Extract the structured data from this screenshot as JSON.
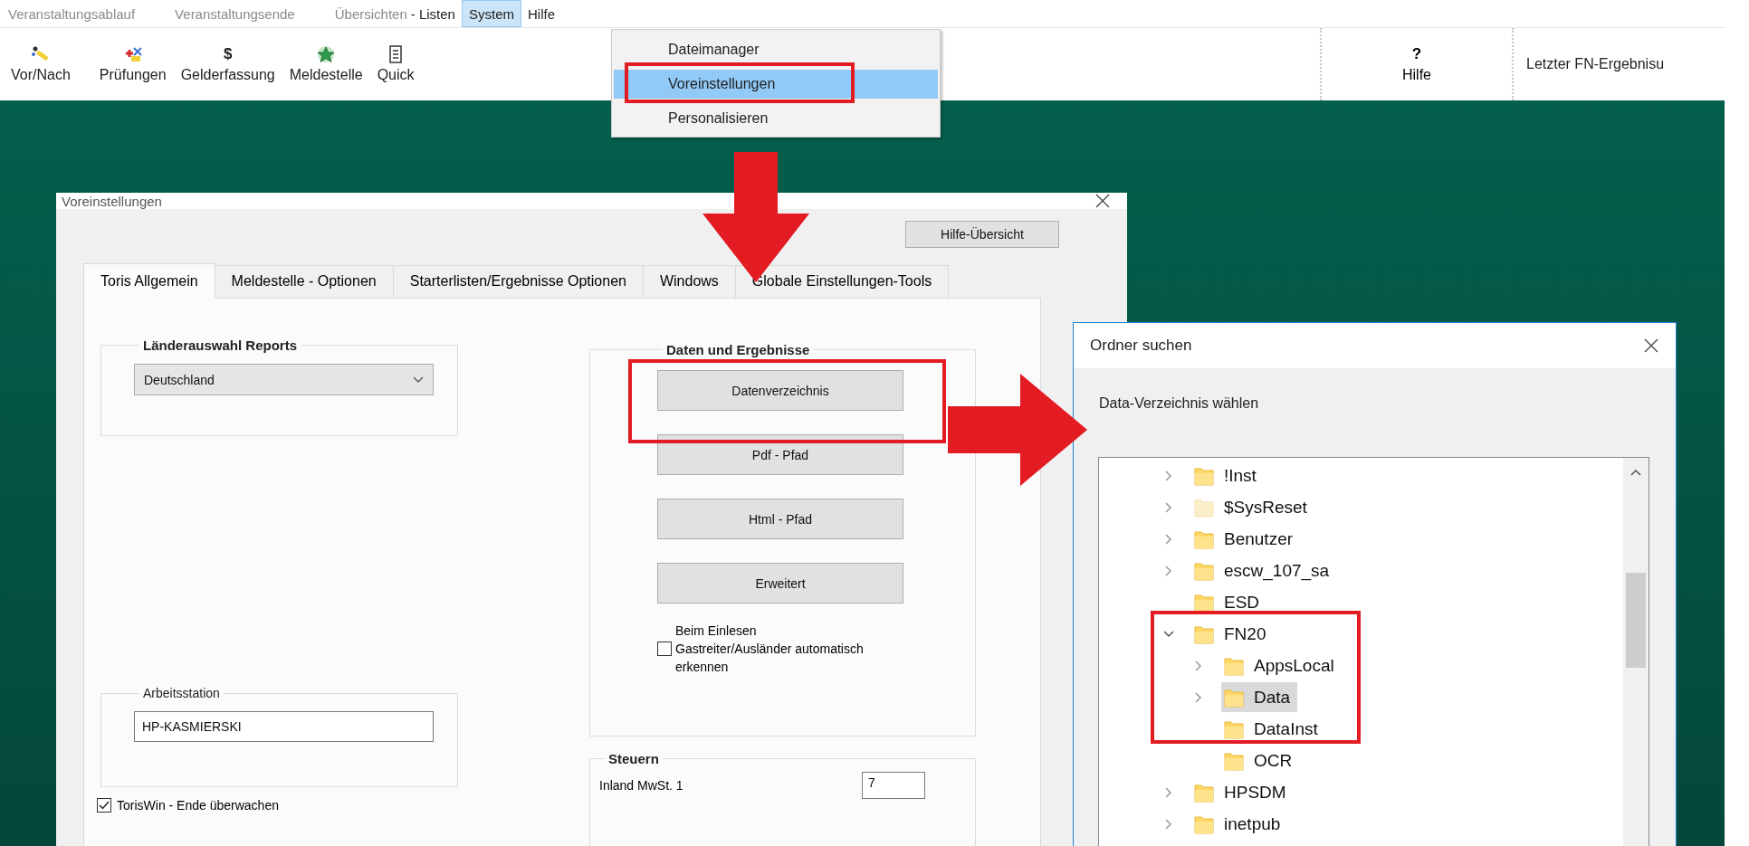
{
  "menu_bar": [
    {
      "label": "Veranstaltungsablauf",
      "disabled": true,
      "selected": false
    },
    {
      "label": "Veranstaltungsende",
      "disabled": true,
      "selected": false
    },
    {
      "label": "Übersichten",
      "disabled": true,
      "selected": false
    },
    {
      "label": "- Listen",
      "disabled": false,
      "selected": false
    },
    {
      "label": "System",
      "disabled": false,
      "selected": true
    },
    {
      "label": "Hilfe",
      "disabled": false,
      "selected": false
    }
  ],
  "system_menu": {
    "items": [
      {
        "label": "Dateimanager",
        "selected": false
      },
      {
        "label": "Voreinstellungen",
        "selected": true
      },
      {
        "label": "Personalisieren",
        "selected": false
      }
    ]
  },
  "toolbar": {
    "buttons": [
      {
        "label": "Vor/Nach",
        "kind": "wand"
      },
      {
        "label": "Prüfungen",
        "kind": "plus"
      },
      {
        "label": "Gelderfassung",
        "kind": "glyph",
        "glyph": "$"
      },
      {
        "label": "Meldestelle",
        "kind": "star"
      },
      {
        "label": "Quick",
        "kind": "document"
      }
    ],
    "help_button": {
      "label": "Hilfe",
      "glyph": "?"
    },
    "status_text": "Letzter FN-Ergebnisu"
  },
  "settings_dialog": {
    "title": "Voreinstellungen",
    "help_button": "Hilfe-Übersicht",
    "tabs": [
      {
        "label": "Toris Allgemein",
        "selected": true
      },
      {
        "label": "Meldestelle - Optionen",
        "selected": false
      },
      {
        "label": "Starterlisten/Ergebnisse Optionen",
        "selected": false
      },
      {
        "label": "Windows",
        "selected": false
      },
      {
        "label": "Globale Einstellungen-Tools",
        "selected": false
      }
    ],
    "country_group": {
      "title": "Länderauswahl Reports",
      "value": "Deutschland"
    },
    "workstation_group": {
      "title": "Arbeitsstation",
      "value": "HP-KASMIERSKI"
    },
    "monitor_checkbox": {
      "label": "TorisWin - Ende überwachen",
      "checked": true
    },
    "data_group": {
      "title": "Daten und Ergebnisse",
      "buttons": [
        "Datenverzeichnis",
        "Pdf - Pfad",
        "Html - Pfad",
        "Erweitert"
      ],
      "guest_checkbox": {
        "label": "Beim Einlesen\nGastreiter/Ausländer automatisch\nerkennen",
        "checked": false
      }
    },
    "tax_group": {
      "title": "Steuern",
      "fields": [
        {
          "label": "Inland MwSt. 1",
          "value": "7"
        }
      ]
    }
  },
  "folder_dialog": {
    "title": "Ordner suchen",
    "prompt": "Data-Verzeichnis wählen",
    "tree": [
      {
        "label": "!Inst",
        "expandable": true,
        "expanded": false,
        "hidden": false,
        "selected": false
      },
      {
        "label": "$SysReset",
        "expandable": true,
        "expanded": false,
        "hidden": true,
        "selected": false
      },
      {
        "label": "Benutzer",
        "expandable": true,
        "expanded": false,
        "hidden": false,
        "selected": false
      },
      {
        "label": "escw_107_sa",
        "expandable": true,
        "expanded": false,
        "hidden": false,
        "selected": false
      },
      {
        "label": "ESD",
        "expandable": false,
        "hidden": false,
        "selected": false
      },
      {
        "label": "FN20",
        "expandable": true,
        "expanded": true,
        "hidden": false,
        "selected": false,
        "children": [
          {
            "label": "AppsLocal",
            "expandable": true,
            "expanded": false,
            "hidden": false,
            "selected": false
          },
          {
            "label": "Data",
            "expandable": true,
            "expanded": false,
            "hidden": false,
            "selected": true
          },
          {
            "label": "DataInst",
            "expandable": false,
            "hidden": false,
            "selected": false
          },
          {
            "label": "OCR",
            "expandable": false,
            "hidden": false,
            "selected": false
          }
        ]
      },
      {
        "label": "HPSDM",
        "expandable": true,
        "expanded": false,
        "hidden": false,
        "selected": false
      },
      {
        "label": "inetpub",
        "expandable": true,
        "expanded": false,
        "hidden": false,
        "selected": false
      }
    ]
  }
}
